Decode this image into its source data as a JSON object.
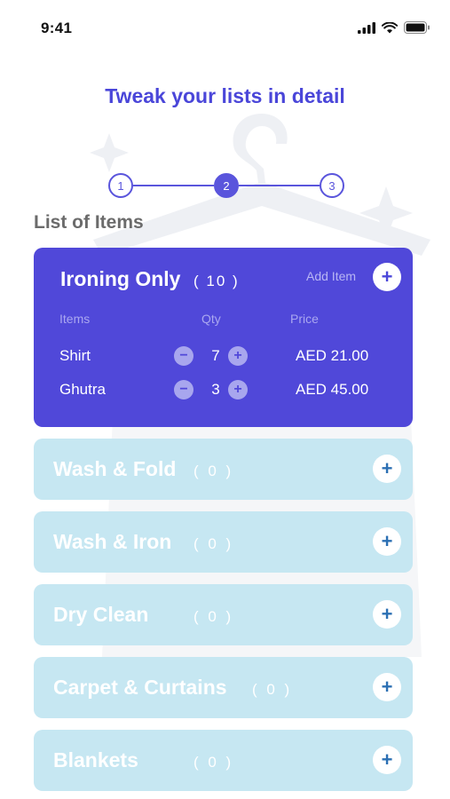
{
  "status_bar": {
    "time": "9:41"
  },
  "title": "Tweak your lists in detail",
  "stepper": {
    "steps": [
      "1",
      "2",
      "3"
    ],
    "active_step": 2
  },
  "section_title": "List of Items",
  "active_category": {
    "name": "Ironing Only",
    "count": "( 10 )",
    "add_label": "Add Item",
    "add_symbol": "+",
    "columns": {
      "items": "Items",
      "qty": "Qty",
      "price": "Price"
    },
    "items": [
      {
        "name": "Shirt",
        "qty": "7",
        "price": "AED 21.00",
        "minus": "−",
        "plus": "+"
      },
      {
        "name": "Ghutra",
        "qty": "3",
        "price": "AED 45.00",
        "minus": "−",
        "plus": "+"
      }
    ]
  },
  "categories": [
    {
      "name": "Wash & Fold",
      "count": "( 0 )",
      "add_symbol": "+"
    },
    {
      "name": "Wash & Iron",
      "count": "( 0 )",
      "add_symbol": "+"
    },
    {
      "name": "Dry Clean",
      "count": "( 0 )",
      "add_symbol": "+"
    },
    {
      "name": "Carpet & Curtains",
      "count": "( 0 )",
      "add_symbol": "+"
    },
    {
      "name": "Blankets",
      "count": "( 0 )",
      "add_symbol": "+"
    }
  ],
  "colors": {
    "primary": "#5048d9",
    "inactive_card": "#c6e7f2",
    "title": "#4a46d9"
  }
}
